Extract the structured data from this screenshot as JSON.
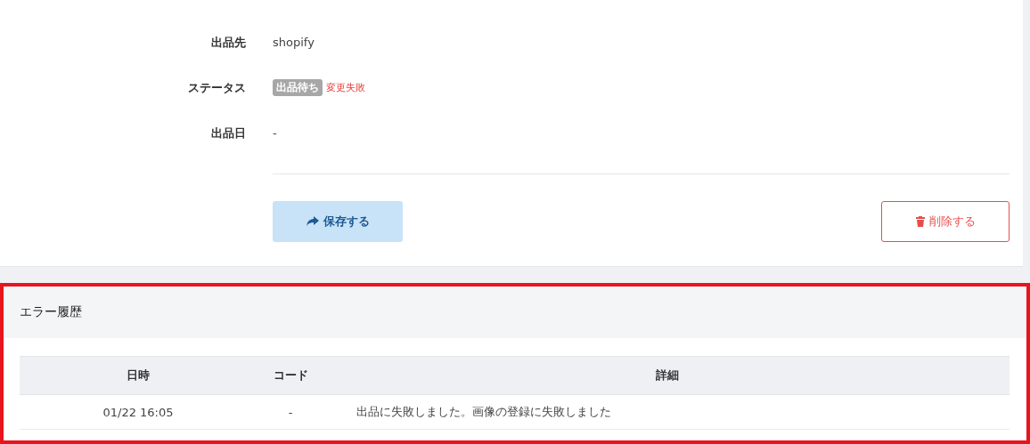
{
  "form": {
    "fields": [
      {
        "label": "出品先",
        "kind": "text",
        "value": "shopify"
      },
      {
        "label": "ステータス",
        "kind": "status",
        "badge": "出品待ち",
        "note": "変更失敗"
      },
      {
        "label": "出品日",
        "kind": "text",
        "value": "-"
      }
    ],
    "save_button": {
      "kind": "save",
      "label": "保存する"
    },
    "delete_button": {
      "kind": "delete",
      "label": "削除する"
    }
  },
  "error_history": {
    "title": "エラー履歴",
    "highlighted": true,
    "table": {
      "columns": [
        "日時",
        "コード",
        "詳細"
      ],
      "rows": [
        [
          "01/22 16:05",
          "-",
          "出品に失敗しました。画像の登録に失敗しました"
        ]
      ]
    }
  }
}
